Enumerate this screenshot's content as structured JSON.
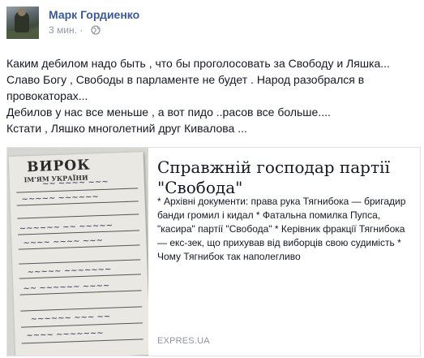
{
  "post": {
    "author": "Марк Гордиенко",
    "time": "3 мин.",
    "privacy_icon": "globe-icon",
    "lines": [
      "Каким дебилом надо быть , что бы проголосовать за Свободу и Ляшка...",
      "Славо Богу , Свободы в парламенте не будет . Народ разобрался в",
      "провокаторах...",
      "Дебилов у нас все меньше , а вот пидо ..расов все больше....",
      "Кстати , Ляшко многолетний друг Кивалова ..."
    ]
  },
  "link_card": {
    "image_heading": "ВИРОК",
    "image_subheading": "ІМ'ЯМ УКРАЇНИ",
    "title": "Справжній господар партії \"Свобода\"",
    "description": "* Архівні документи: права рука Тягнибока — бригадир банди громил і кидал * Фатальна помилка Пупса, \"касира\" партії \"Свобода\" * Керівник фракції Тягнибока — екс-зек, що прихував від виборців свою судимість * Чому Тягнибок так наполегливо",
    "source": "EXPRES.UA"
  },
  "colors": {
    "author_link": "#3b5998",
    "meta_text": "#9197a3",
    "body_text": "#141823",
    "card_border": "#e1e2e3"
  }
}
